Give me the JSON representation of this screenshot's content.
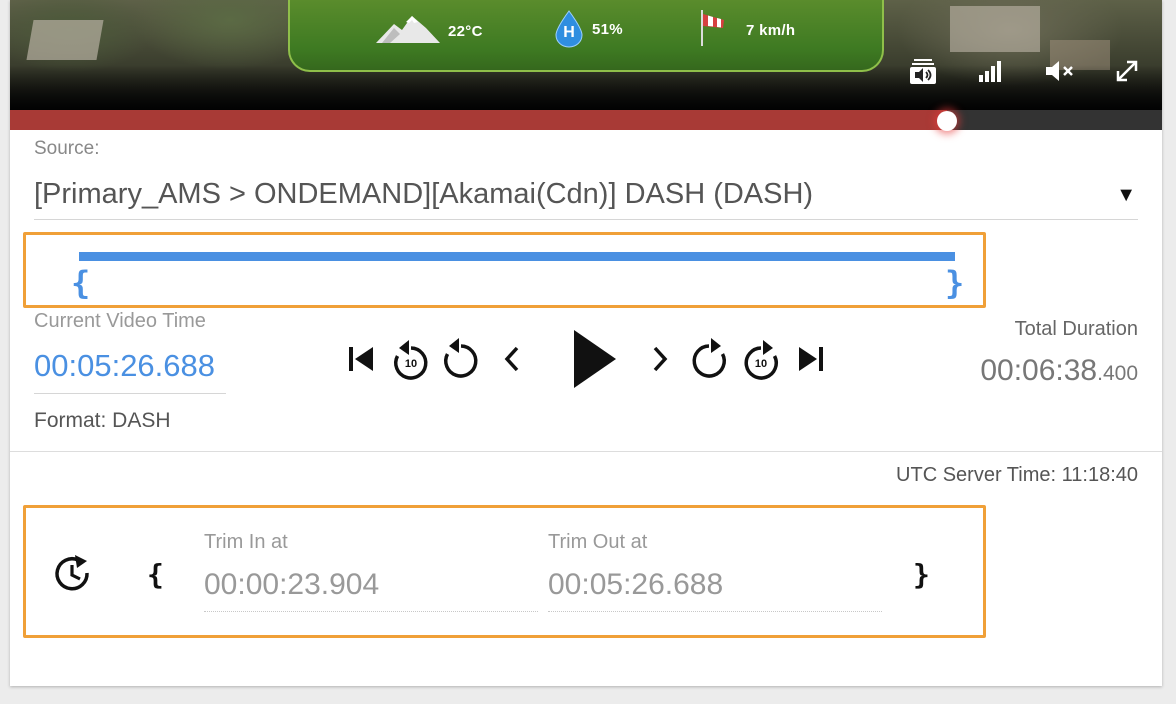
{
  "video": {
    "weather": {
      "temperature": "22°C",
      "humidity": "51%",
      "humidity_icon_letter": "H",
      "wind": "7 km/h"
    },
    "progress_fraction": 0.8133,
    "colors": {
      "progress_played": "#a83a36",
      "progress_rest": "#333333",
      "weather_panel": "#4a8a28"
    }
  },
  "source": {
    "label": "Source:",
    "selected": "[Primary_AMS > ONDEMAND][Akamai(Cdn)] DASH (DASH)",
    "arrow": "▼"
  },
  "range": {
    "open_brace": "{",
    "close_brace": "}",
    "color": "#4a90e2"
  },
  "current": {
    "label": "Current Video Time",
    "value": "00:05:26.688",
    "format": "Format: DASH"
  },
  "duration": {
    "label": "Total Duration",
    "main": "00:06:38",
    "ms": ".400"
  },
  "controls": {
    "skip_amount": "10",
    "icons": [
      "skip-to-start-icon",
      "rewind-10-icon",
      "replay-icon",
      "step-back-icon",
      "play-icon",
      "step-forward-icon",
      "forward-icon",
      "forward-10-icon",
      "skip-to-end-icon"
    ]
  },
  "utc": "UTC Server Time: 11:18:40",
  "trim": {
    "open_brace": "{",
    "close_brace": "}",
    "in_label": "Trim In at",
    "in_value": "00:00:23.904",
    "out_label": "Trim Out at",
    "out_value": "00:05:26.688"
  },
  "accent_colors": {
    "highlight_border": "#f0a038",
    "blue": "#4a90e2"
  }
}
